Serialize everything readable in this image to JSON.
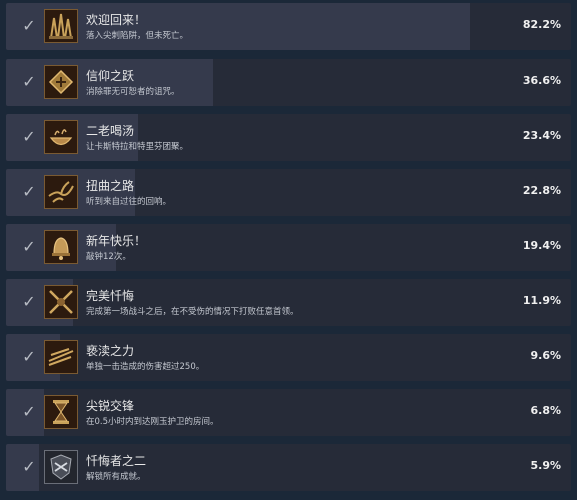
{
  "achievements": [
    {
      "title": "欢迎回来！",
      "desc": "落入尖刺陷阱，但未死亡。",
      "percent": "82.2%",
      "fill": 0.822,
      "icon": "spike-trap-icon"
    },
    {
      "title": "信仰之跃",
      "desc": "消除罪无可恕者的诅咒。",
      "percent": "36.6%",
      "fill": 0.366,
      "icon": "rune-tablet-icon"
    },
    {
      "title": "二老喝汤",
      "desc": "让卡斯特拉和特里芬团聚。",
      "percent": "23.4%",
      "fill": 0.234,
      "icon": "soup-bowl-icon"
    },
    {
      "title": "扭曲之路",
      "desc": "听到来自过往的回响。",
      "percent": "22.8%",
      "fill": 0.228,
      "icon": "twisted-roots-icon"
    },
    {
      "title": "新年快乐！",
      "desc": "敲钟12次。",
      "percent": "19.4%",
      "fill": 0.194,
      "icon": "bell-icon"
    },
    {
      "title": "完美忏悔",
      "desc": "完成第一场战斗之后，在不受伤的情况下打败任意首领。",
      "percent": "11.9%",
      "fill": 0.119,
      "icon": "crossed-blades-icon"
    },
    {
      "title": "亵渎之力",
      "desc": "单独一击造成的伤害超过250。",
      "percent": "9.6%",
      "fill": 0.096,
      "icon": "sword-strike-icon"
    },
    {
      "title": "尖锐交锋",
      "desc": "在0.5小时内到达刚玉护卫的房间。",
      "percent": "6.8%",
      "fill": 0.068,
      "icon": "hourglass-icon"
    },
    {
      "title": "忏悔者之二",
      "desc": "解锁所有成就。",
      "percent": "5.9%",
      "fill": 0.059,
      "icon": "penitent-mask-icon"
    }
  ]
}
